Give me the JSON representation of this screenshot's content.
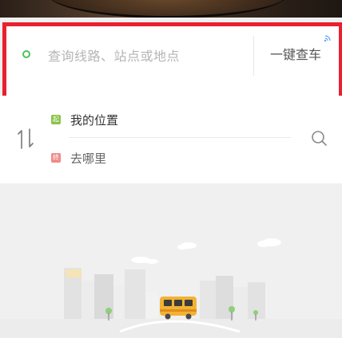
{
  "banner": {
    "image": "food-photo"
  },
  "search": {
    "placeholder": "查询线路、站点或地点",
    "quick_button": "一键查车",
    "location_icon": "location-dot-icon",
    "signal_icon": "signal-wave-icon",
    "highlight_color": "#e8202f"
  },
  "route": {
    "from_tag": "起",
    "from_label": "我的位置",
    "to_tag": "终",
    "to_label": "去哪里",
    "from_tag_color": "#8bc34a",
    "to_tag_color": "#ef8a8a",
    "swap_icon": "swap-vertical-icon",
    "search_icon": "search-icon"
  },
  "illustration": {
    "subject": "city-skyline-with-bus",
    "bus_color": "#f2b233"
  }
}
